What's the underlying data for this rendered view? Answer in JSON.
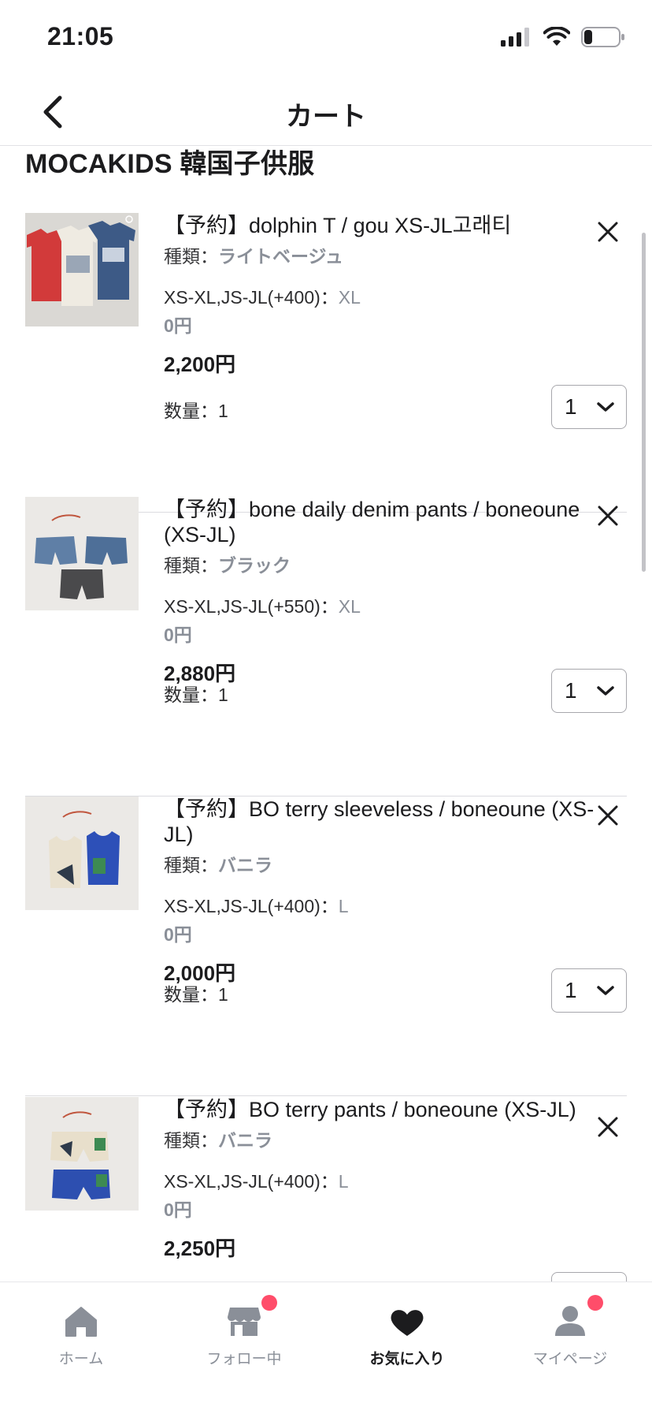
{
  "status_bar": {
    "time": "21:05"
  },
  "nav": {
    "title": "カート"
  },
  "shop": {
    "name": "MOCAKIDS 韓国子供服"
  },
  "items": [
    {
      "title": "【予約】dolphin T / gou XS-JL고래티",
      "kind_label": "種類：",
      "kind_value": "ライトベージュ",
      "option_label": "XS-XL,JS-JL(+400)：",
      "option_value": "XL",
      "option_price": "0円",
      "price": "2,200円",
      "qty_label": "数量：1",
      "qty_value": "1"
    },
    {
      "title": "【予約】bone daily denim pants  / boneoune (XS-JL)",
      "kind_label": "種類：",
      "kind_value": "ブラック",
      "option_label": "XS-XL,JS-JL(+550)：",
      "option_value": "XL",
      "option_price": "0円",
      "price": "2,880円",
      "qty_label": "数量：1",
      "qty_value": "1"
    },
    {
      "title": "【予約】BO terry sleeveless / boneoune (XS-JL)",
      "kind_label": "種類：",
      "kind_value": "バニラ",
      "option_label": "XS-XL,JS-JL(+400)：",
      "option_value": "L",
      "option_price": "0円",
      "price": "2,000円",
      "qty_label": "数量：1",
      "qty_value": "1"
    },
    {
      "title": "【予約】BO terry pants / boneoune (XS-JL)",
      "kind_label": "種類：",
      "kind_value": "バニラ",
      "option_label": "XS-XL,JS-JL(+400)：",
      "option_value": "L",
      "option_price": "0円",
      "price": "2,250円"
    }
  ],
  "tabs": [
    {
      "label": "ホーム",
      "icon": "home-icon",
      "active": false,
      "badge": false
    },
    {
      "label": "フォロー中",
      "icon": "store-icon",
      "active": false,
      "badge": true
    },
    {
      "label": "お気に入り",
      "icon": "heart-icon",
      "active": true,
      "badge": false
    },
    {
      "label": "マイページ",
      "icon": "person-icon",
      "active": false,
      "badge": true
    }
  ],
  "colors": {
    "accent_badge": "#ff4d6a",
    "muted": "#8a8f98",
    "text": "#1c1c1e"
  }
}
